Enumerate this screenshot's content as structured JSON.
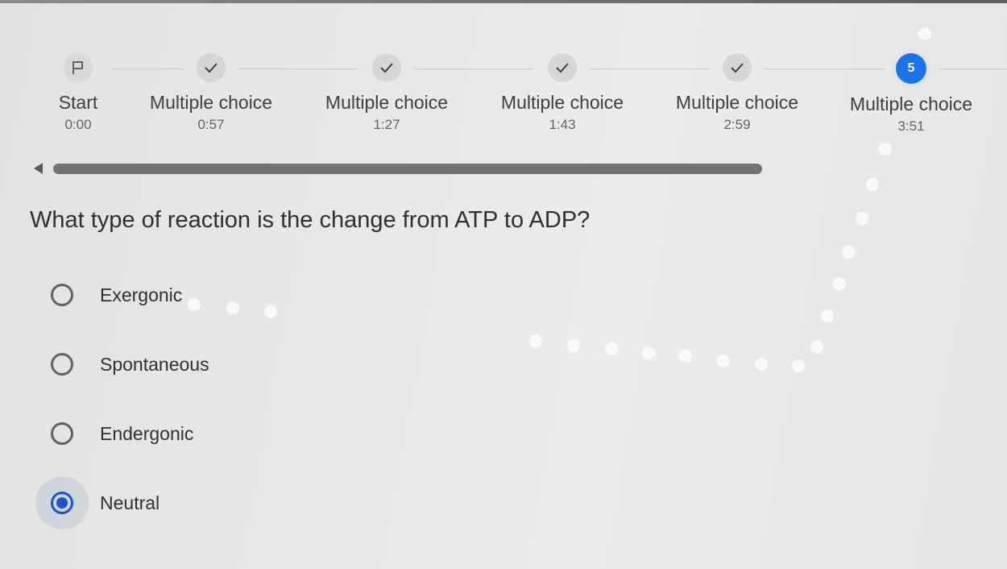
{
  "stepper": {
    "steps": [
      {
        "label": "Start",
        "time": "0:00",
        "state": "start",
        "icon": "flag-icon"
      },
      {
        "label": "Multiple choice",
        "time": "0:57",
        "state": "done",
        "icon": "check-icon"
      },
      {
        "label": "Multiple choice",
        "time": "1:27",
        "state": "done",
        "icon": "check-icon"
      },
      {
        "label": "Multiple choice",
        "time": "1:43",
        "state": "done",
        "icon": "check-icon"
      },
      {
        "label": "Multiple choice",
        "time": "2:59",
        "state": "done",
        "icon": "check-icon"
      },
      {
        "label": "Multiple choice",
        "time": "3:51",
        "state": "current",
        "number": "5"
      }
    ]
  },
  "question": {
    "text": "What type of reaction is the change from ATP to ADP?",
    "options": [
      {
        "label": "Exergonic",
        "selected": false
      },
      {
        "label": "Spontaneous",
        "selected": false
      },
      {
        "label": "Endergonic",
        "selected": false
      },
      {
        "label": "Neutral",
        "selected": true
      }
    ]
  },
  "colors": {
    "accent": "#1a73e8",
    "selected_radio": "#1a56c4",
    "background": "#e8e8e7"
  }
}
